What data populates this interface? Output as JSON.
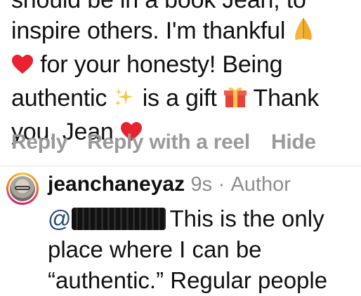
{
  "comment1": {
    "line1": "should be in a book Jean, to",
    "line2_text": "inspire others.  I'm thankful",
    "line3_text": "for your honesty!  Being",
    "line4_a": "authentic",
    "line4_b": "is a gift",
    "line4_c": "Thank",
    "line5_text": "you, Jean",
    "emojis": [
      "folded-hands",
      "red-heart",
      "sparkles",
      "wrapped-gift",
      "red-heart"
    ]
  },
  "actions": {
    "reply": "Reply",
    "reply_reel": "Reply with a reel",
    "hide": "Hide"
  },
  "comment2": {
    "username": "jeanchaneyaz",
    "time": "9s",
    "separator": "·",
    "badge": "Author",
    "mention_prefix": "@",
    "redacted_username": "[redacted]",
    "line1_text": "This is the only",
    "line2_text": "place where I can be",
    "line3_text": "“authentic.” Regular people"
  }
}
